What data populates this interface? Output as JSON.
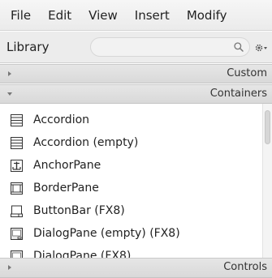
{
  "menu": {
    "items": [
      {
        "label": "File"
      },
      {
        "label": "Edit"
      },
      {
        "label": "View"
      },
      {
        "label": "Insert"
      },
      {
        "label": "Modify"
      }
    ]
  },
  "library": {
    "title": "Library",
    "search_value": "",
    "search_icon": "magnifier-icon",
    "settings_icon": "gear-dropdown-icon"
  },
  "sections": {
    "custom": {
      "label": "Custom",
      "expanded": false
    },
    "containers": {
      "label": "Containers",
      "expanded": true
    },
    "controls": {
      "label": "Controls",
      "expanded": false
    }
  },
  "containers": {
    "items": [
      {
        "label": "Accordion",
        "icon": "accordion-icon"
      },
      {
        "label": "Accordion  (empty)",
        "icon": "accordion-icon"
      },
      {
        "label": "AnchorPane",
        "icon": "anchor-icon"
      },
      {
        "label": "BorderPane",
        "icon": "borderpane-icon"
      },
      {
        "label": "ButtonBar  (FX8)",
        "icon": "buttonbar-icon"
      },
      {
        "label": "DialogPane (empty)  (FX8)",
        "icon": "dialogpane-icon"
      },
      {
        "label": "DialogPane  (FX8)",
        "icon": "dialogpane-icon"
      }
    ]
  },
  "colors": {
    "accent": "#3a5f8f"
  }
}
